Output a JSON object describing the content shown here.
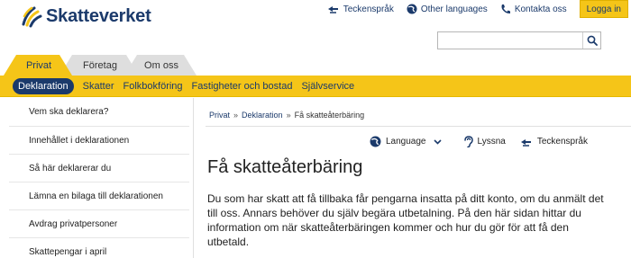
{
  "header": {
    "logo_text": "Skatteverket",
    "links": [
      {
        "label": "Teckenspråk",
        "icon": "sign-language-icon"
      },
      {
        "label": "Other languages",
        "icon": "globe-icon"
      },
      {
        "label": "Kontakta oss",
        "icon": "phone-icon"
      }
    ],
    "login_label": "Logga in",
    "search": {
      "value": "",
      "placeholder": ""
    }
  },
  "tabs": [
    {
      "label": "Privat",
      "active": true
    },
    {
      "label": "Företag",
      "active": false
    },
    {
      "label": "Om oss",
      "active": false
    }
  ],
  "nav": [
    {
      "label": "Deklaration",
      "active": true
    },
    {
      "label": "Skatter",
      "active": false
    },
    {
      "label": "Folkbokföring",
      "active": false
    },
    {
      "label": "Fastigheter och bostad",
      "active": false
    },
    {
      "label": "Självservice",
      "active": false
    }
  ],
  "sidebar": [
    {
      "label": "Vem ska deklarera?"
    },
    {
      "label": "Innehållet i deklarationen"
    },
    {
      "label": "Så här deklarerar du"
    },
    {
      "label": "Lämna en bilaga till deklarationen"
    },
    {
      "label": "Avdrag privatpersoner"
    },
    {
      "label": "Skattepengar i april"
    }
  ],
  "breadcrumb": [
    {
      "label": "Privat",
      "link": true
    },
    {
      "label": "Deklaration",
      "link": true
    },
    {
      "label": "Få skatteåterbäring",
      "link": false
    }
  ],
  "tools": {
    "language_label": "Language",
    "listen_label": "Lyssna",
    "sign_label": "Teckenspråk"
  },
  "main": {
    "title": "Få skatteåterbäring",
    "intro": "Du som har skatt att få tillbaka får pengarna insatta på ditt konto, om du anmält det till oss. Annars behöver du själv begära utbetalning. På den här sidan hittar du information om när skatteåterbäringen kommer och hur du gör för att få den utbetald."
  },
  "colors": {
    "brand_yellow": "#f5c518",
    "brand_navy": "#1b3a6b",
    "tab_inactive": "#dedede"
  }
}
